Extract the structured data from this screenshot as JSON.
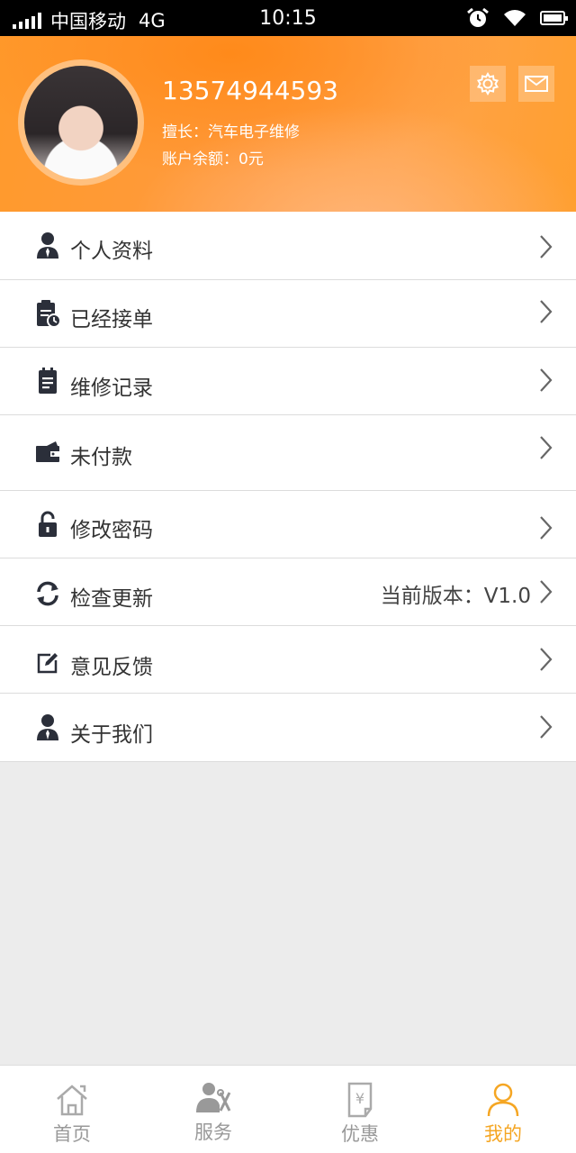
{
  "status_bar": {
    "carrier": "中国移动",
    "network": "4G",
    "time": "10:15"
  },
  "profile": {
    "phone": "13574944593",
    "specialty": "擅长：汽车电子维修",
    "balance": "账户余额：0元"
  },
  "header_actions": {
    "settings_icon": "gear-icon",
    "message_icon": "envelope-icon"
  },
  "menu": {
    "items": [
      {
        "label": "个人资料",
        "icon": "person-icon"
      },
      {
        "label": "已经接单",
        "icon": "clipboard-clock-icon"
      },
      {
        "label": "维修记录",
        "icon": "notepad-icon"
      },
      {
        "label": "未付款",
        "icon": "wallet-icon"
      },
      {
        "label": "修改密码",
        "icon": "lock-icon"
      },
      {
        "label": "检查更新",
        "icon": "refresh-icon",
        "extra": "当前版本：V1.0"
      },
      {
        "label": "意见反馈",
        "icon": "edit-icon"
      },
      {
        "label": "关于我们",
        "icon": "person-icon"
      }
    ]
  },
  "tabbar": {
    "tabs": [
      {
        "label": "首页",
        "icon": "home-icon"
      },
      {
        "label": "服务",
        "icon": "worker-icon"
      },
      {
        "label": "优惠",
        "icon": "coupon-icon"
      },
      {
        "label": "我的",
        "icon": "user-icon",
        "active": true
      }
    ],
    "active_color": "#f5a623",
    "inactive_color": "#999999"
  },
  "colors": {
    "header_orange": "#ff9a2c",
    "background": "#ececec"
  }
}
